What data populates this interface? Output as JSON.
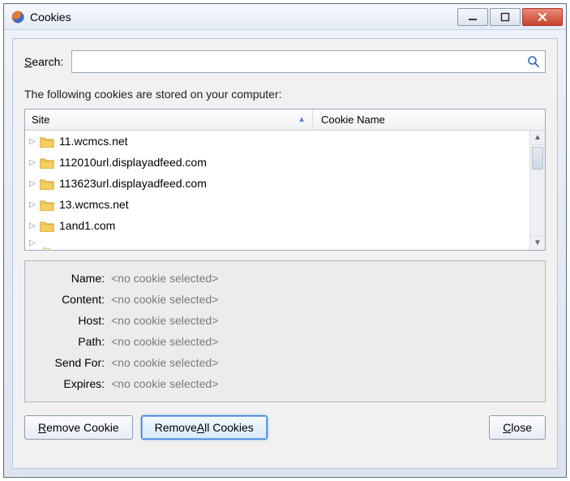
{
  "titlebar": {
    "title": "Cookies"
  },
  "search": {
    "label": "Search:",
    "value": ""
  },
  "description": "The following cookies are stored on your computer:",
  "columns": {
    "site": "Site",
    "cookie": "Cookie Name"
  },
  "rows": [
    {
      "site": "11.wcmcs.net"
    },
    {
      "site": "112010url.displayadfeed.com"
    },
    {
      "site": "113623url.displayadfeed.com"
    },
    {
      "site": "13.wcmcs.net"
    },
    {
      "site": "1and1.com"
    }
  ],
  "details": {
    "name": {
      "label": "Name:",
      "value": "<no cookie selected>"
    },
    "content": {
      "label": "Content:",
      "value": "<no cookie selected>"
    },
    "host": {
      "label": "Host:",
      "value": "<no cookie selected>"
    },
    "path": {
      "label": "Path:",
      "value": "<no cookie selected>"
    },
    "sendfor": {
      "label": "Send For:",
      "value": "<no cookie selected>"
    },
    "expires": {
      "label": "Expires:",
      "value": "<no cookie selected>"
    }
  },
  "buttons": {
    "remove": "Remove Cookie",
    "removeAll": "Remove All Cookies",
    "close": "Close"
  }
}
